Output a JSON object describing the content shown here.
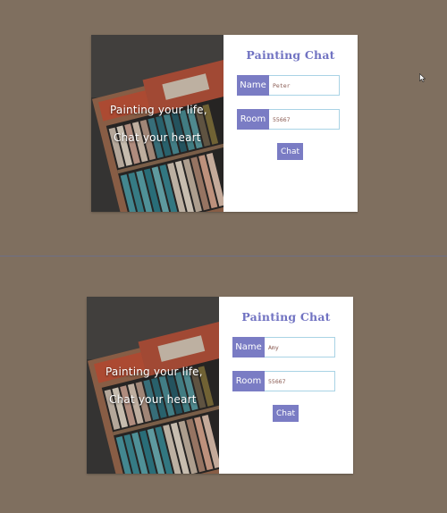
{
  "app": {
    "title": "Painting Chat",
    "tagline_line1": "Painting your life,",
    "tagline_line2": "Chat your heart",
    "accent_color": "#7a7cc4",
    "background_color": "#7f6f5f"
  },
  "cards": [
    {
      "name_label": "Name",
      "name_value": "Peter",
      "room_label": "Room",
      "room_value": "55667",
      "chat_label": "Chat"
    },
    {
      "name_label": "Name",
      "name_value": "Amy",
      "room_label": "Room",
      "room_value": "55667",
      "chat_label": "Chat"
    }
  ],
  "icons": {
    "cursor": "mouse-pointer-icon",
    "photo": "pastel-box-photo"
  }
}
